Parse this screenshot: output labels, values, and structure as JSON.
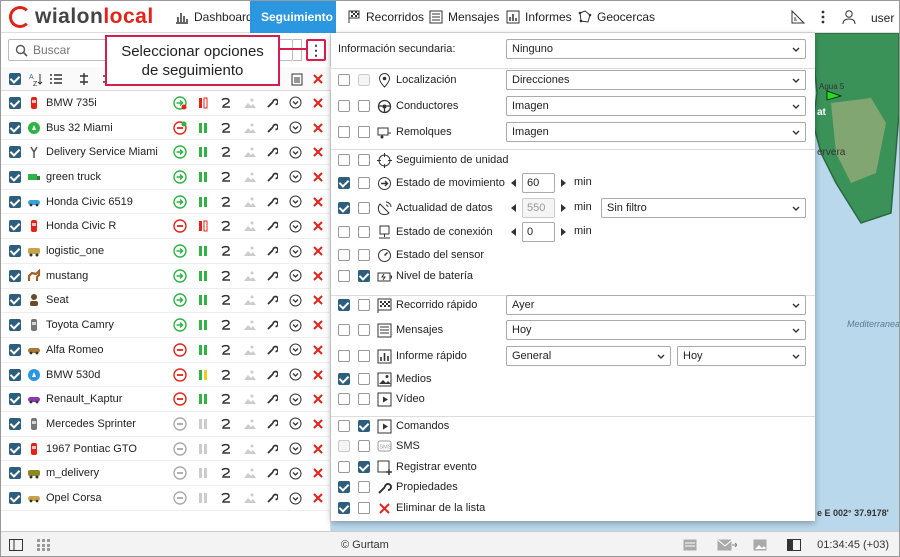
{
  "header": {
    "logo_left": "wialon",
    "logo_right": "local",
    "nav": [
      {
        "label": "Dashboard",
        "icon": "bar-chart-icon"
      },
      {
        "label": "Seguimiento",
        "icon": "globe-icon",
        "active": true
      },
      {
        "label": "Recorridos",
        "icon": "flag-icon"
      },
      {
        "label": "Mensajes",
        "icon": "messages-icon"
      },
      {
        "label": "Informes",
        "icon": "report-icon"
      },
      {
        "label": "Geocercas",
        "icon": "geofence-icon"
      }
    ],
    "user": "user"
  },
  "search": {
    "placeholder": "Buscar"
  },
  "callout": "Seleccionar opciones de seguimiento",
  "units": [
    {
      "name": "BMW 735i",
      "checked": true,
      "state": "moving-alt"
    },
    {
      "name": "Bus 32 Miami",
      "checked": true,
      "state": "stopped-alt"
    },
    {
      "name": "Delivery Service Miami",
      "checked": true,
      "state": "moving"
    },
    {
      "name": "green truck",
      "checked": true,
      "state": "moving"
    },
    {
      "name": "Honda Civic 6519",
      "checked": true,
      "state": "moving"
    },
    {
      "name": "Honda Civic R",
      "checked": true,
      "state": "stopped"
    },
    {
      "name": "logistic_one",
      "checked": true,
      "state": "moving"
    },
    {
      "name": "mustang",
      "checked": true,
      "state": "moving"
    },
    {
      "name": "Seat",
      "checked": true,
      "state": "moving"
    },
    {
      "name": "Toyota Camry",
      "checked": true,
      "state": "moving"
    },
    {
      "name": "Alfa Romeo",
      "checked": true,
      "state": "stopped"
    },
    {
      "name": "BMW 530d",
      "checked": true,
      "state": "stopped"
    },
    {
      "name": "Renault_Kaptur",
      "checked": true,
      "state": "stopped"
    },
    {
      "name": "Mercedes Sprinter",
      "checked": true,
      "state": "offline"
    },
    {
      "name": "1967 Pontiac GTO",
      "checked": true,
      "state": "offline"
    },
    {
      "name": "m_delivery",
      "checked": true,
      "state": "offline"
    },
    {
      "name": "Opel Corsa",
      "checked": true,
      "state": "offline"
    }
  ],
  "menu": {
    "secondary_label": "Información secundaria:",
    "secondary_value": "Ninguno",
    "rows": [
      {
        "label": "Localización",
        "icon": "location-pin-icon",
        "a": false,
        "b": "disabled",
        "select": "Direcciones"
      },
      {
        "label": "Conductores",
        "icon": "steering-wheel-icon",
        "a": false,
        "b": false,
        "select": "Imagen"
      },
      {
        "label": "Remolques",
        "icon": "trailer-icon",
        "a": false,
        "b": false,
        "select": "Imagen"
      },
      {
        "label": "Seguimiento de unidad",
        "icon": "crosshair-icon",
        "a": false,
        "b": false
      },
      {
        "label": "Estado de movimiento",
        "icon": "arrow-circle-icon",
        "a": true,
        "b": false,
        "spin": "60",
        "unit": "min"
      },
      {
        "label": "Actualidad de datos",
        "icon": "satellite-icon",
        "a": true,
        "b": false,
        "spin": "550",
        "spin_disabled": true,
        "unit": "min",
        "select": "Sin filtro"
      },
      {
        "label": "Estado de conexión",
        "icon": "connection-icon",
        "a": false,
        "b": false,
        "spin": "0",
        "unit": "min"
      },
      {
        "label": "Estado del sensor",
        "icon": "gauge-icon",
        "a": false,
        "b": false
      },
      {
        "label": "Nivel de batería",
        "icon": "battery-icon",
        "a": false,
        "b": true
      },
      {
        "label": "Recorrido rápido",
        "icon": "checkered-flag-icon",
        "a": true,
        "b": false,
        "select": "Ayer"
      },
      {
        "label": "Mensajes",
        "icon": "messages-icon",
        "a": false,
        "b": false,
        "select": "Hoy"
      },
      {
        "label": "Informe rápido",
        "icon": "report-icon",
        "a": false,
        "b": false,
        "select": "General",
        "select2": "Hoy"
      },
      {
        "label": "Medios",
        "icon": "image-icon",
        "a": true,
        "b": false
      },
      {
        "label": "Vídeo",
        "icon": "video-icon",
        "a": false,
        "b": false
      },
      {
        "label": "Comandos",
        "icon": "command-icon",
        "a": false,
        "b": true
      },
      {
        "label": "SMS",
        "icon": "sms-icon",
        "a": "disabled",
        "b": false
      },
      {
        "label": "Registrar evento",
        "icon": "register-event-icon",
        "a": false,
        "b": true
      },
      {
        "label": "Propiedades",
        "icon": "wrench-icon",
        "a": true,
        "b": false
      },
      {
        "label": "Eliminar de la lista",
        "icon": "delete-x-icon",
        "a": true,
        "b": false
      }
    ]
  },
  "map": {
    "labels": [
      "Agua 5",
      "at",
      "ervera",
      "Mediterranea",
      "e E 002° 37.9178'"
    ]
  },
  "footer": {
    "copyright": "© Gurtam",
    "time": "01:34:45 (+03)"
  },
  "colors": {
    "accent": "#2b97e0",
    "callout": "#d51e4b",
    "green": "#2fb344",
    "red": "#e2231a"
  }
}
